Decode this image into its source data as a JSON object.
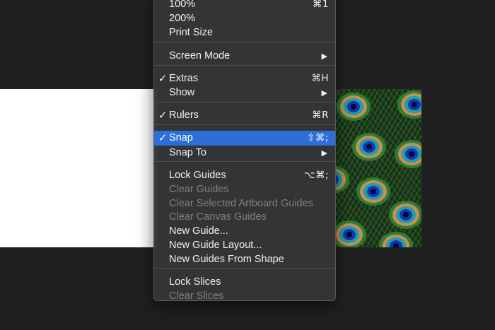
{
  "menu": {
    "items": [
      {
        "label": "100%",
        "shortcut": "⌘1",
        "checked": false,
        "disabled": false,
        "submenu": false
      },
      {
        "label": "200%",
        "shortcut": "",
        "checked": false,
        "disabled": false,
        "submenu": false
      },
      {
        "label": "Print Size",
        "shortcut": "",
        "checked": false,
        "disabled": false,
        "submenu": false
      },
      {
        "label": "Screen Mode",
        "shortcut": "",
        "checked": false,
        "disabled": false,
        "submenu": true
      },
      {
        "label": "Extras",
        "shortcut": "⌘H",
        "checked": true,
        "disabled": false,
        "submenu": false
      },
      {
        "label": "Show",
        "shortcut": "",
        "checked": false,
        "disabled": false,
        "submenu": true
      },
      {
        "label": "Rulers",
        "shortcut": "⌘R",
        "checked": true,
        "disabled": false,
        "submenu": false
      },
      {
        "label": "Snap",
        "shortcut": "⇧⌘;",
        "checked": true,
        "disabled": false,
        "submenu": false,
        "highlighted": true
      },
      {
        "label": "Snap To",
        "shortcut": "",
        "checked": false,
        "disabled": false,
        "submenu": true
      },
      {
        "label": "Lock Guides",
        "shortcut": "⌥⌘;",
        "checked": false,
        "disabled": false,
        "submenu": false
      },
      {
        "label": "Clear Guides",
        "shortcut": "",
        "checked": false,
        "disabled": true,
        "submenu": false
      },
      {
        "label": "Clear Selected Artboard Guides",
        "shortcut": "",
        "checked": false,
        "disabled": true,
        "submenu": false
      },
      {
        "label": "Clear Canvas Guides",
        "shortcut": "",
        "checked": false,
        "disabled": true,
        "submenu": false
      },
      {
        "label": "New Guide...",
        "shortcut": "",
        "checked": false,
        "disabled": false,
        "submenu": false
      },
      {
        "label": "New Guide Layout...",
        "shortcut": "",
        "checked": false,
        "disabled": false,
        "submenu": false
      },
      {
        "label": "New Guides From Shape",
        "shortcut": "",
        "checked": false,
        "disabled": false,
        "submenu": false
      },
      {
        "label": "Lock Slices",
        "shortcut": "",
        "checked": false,
        "disabled": false,
        "submenu": false
      },
      {
        "label": "Clear Slices",
        "shortcut": "",
        "checked": false,
        "disabled": true,
        "submenu": false
      }
    ],
    "check_glyph": "✓",
    "submenu_glyph": "▶",
    "highlight_color": "#2d6fd8"
  },
  "canvas": {
    "image": "peacock-feathers-image"
  }
}
